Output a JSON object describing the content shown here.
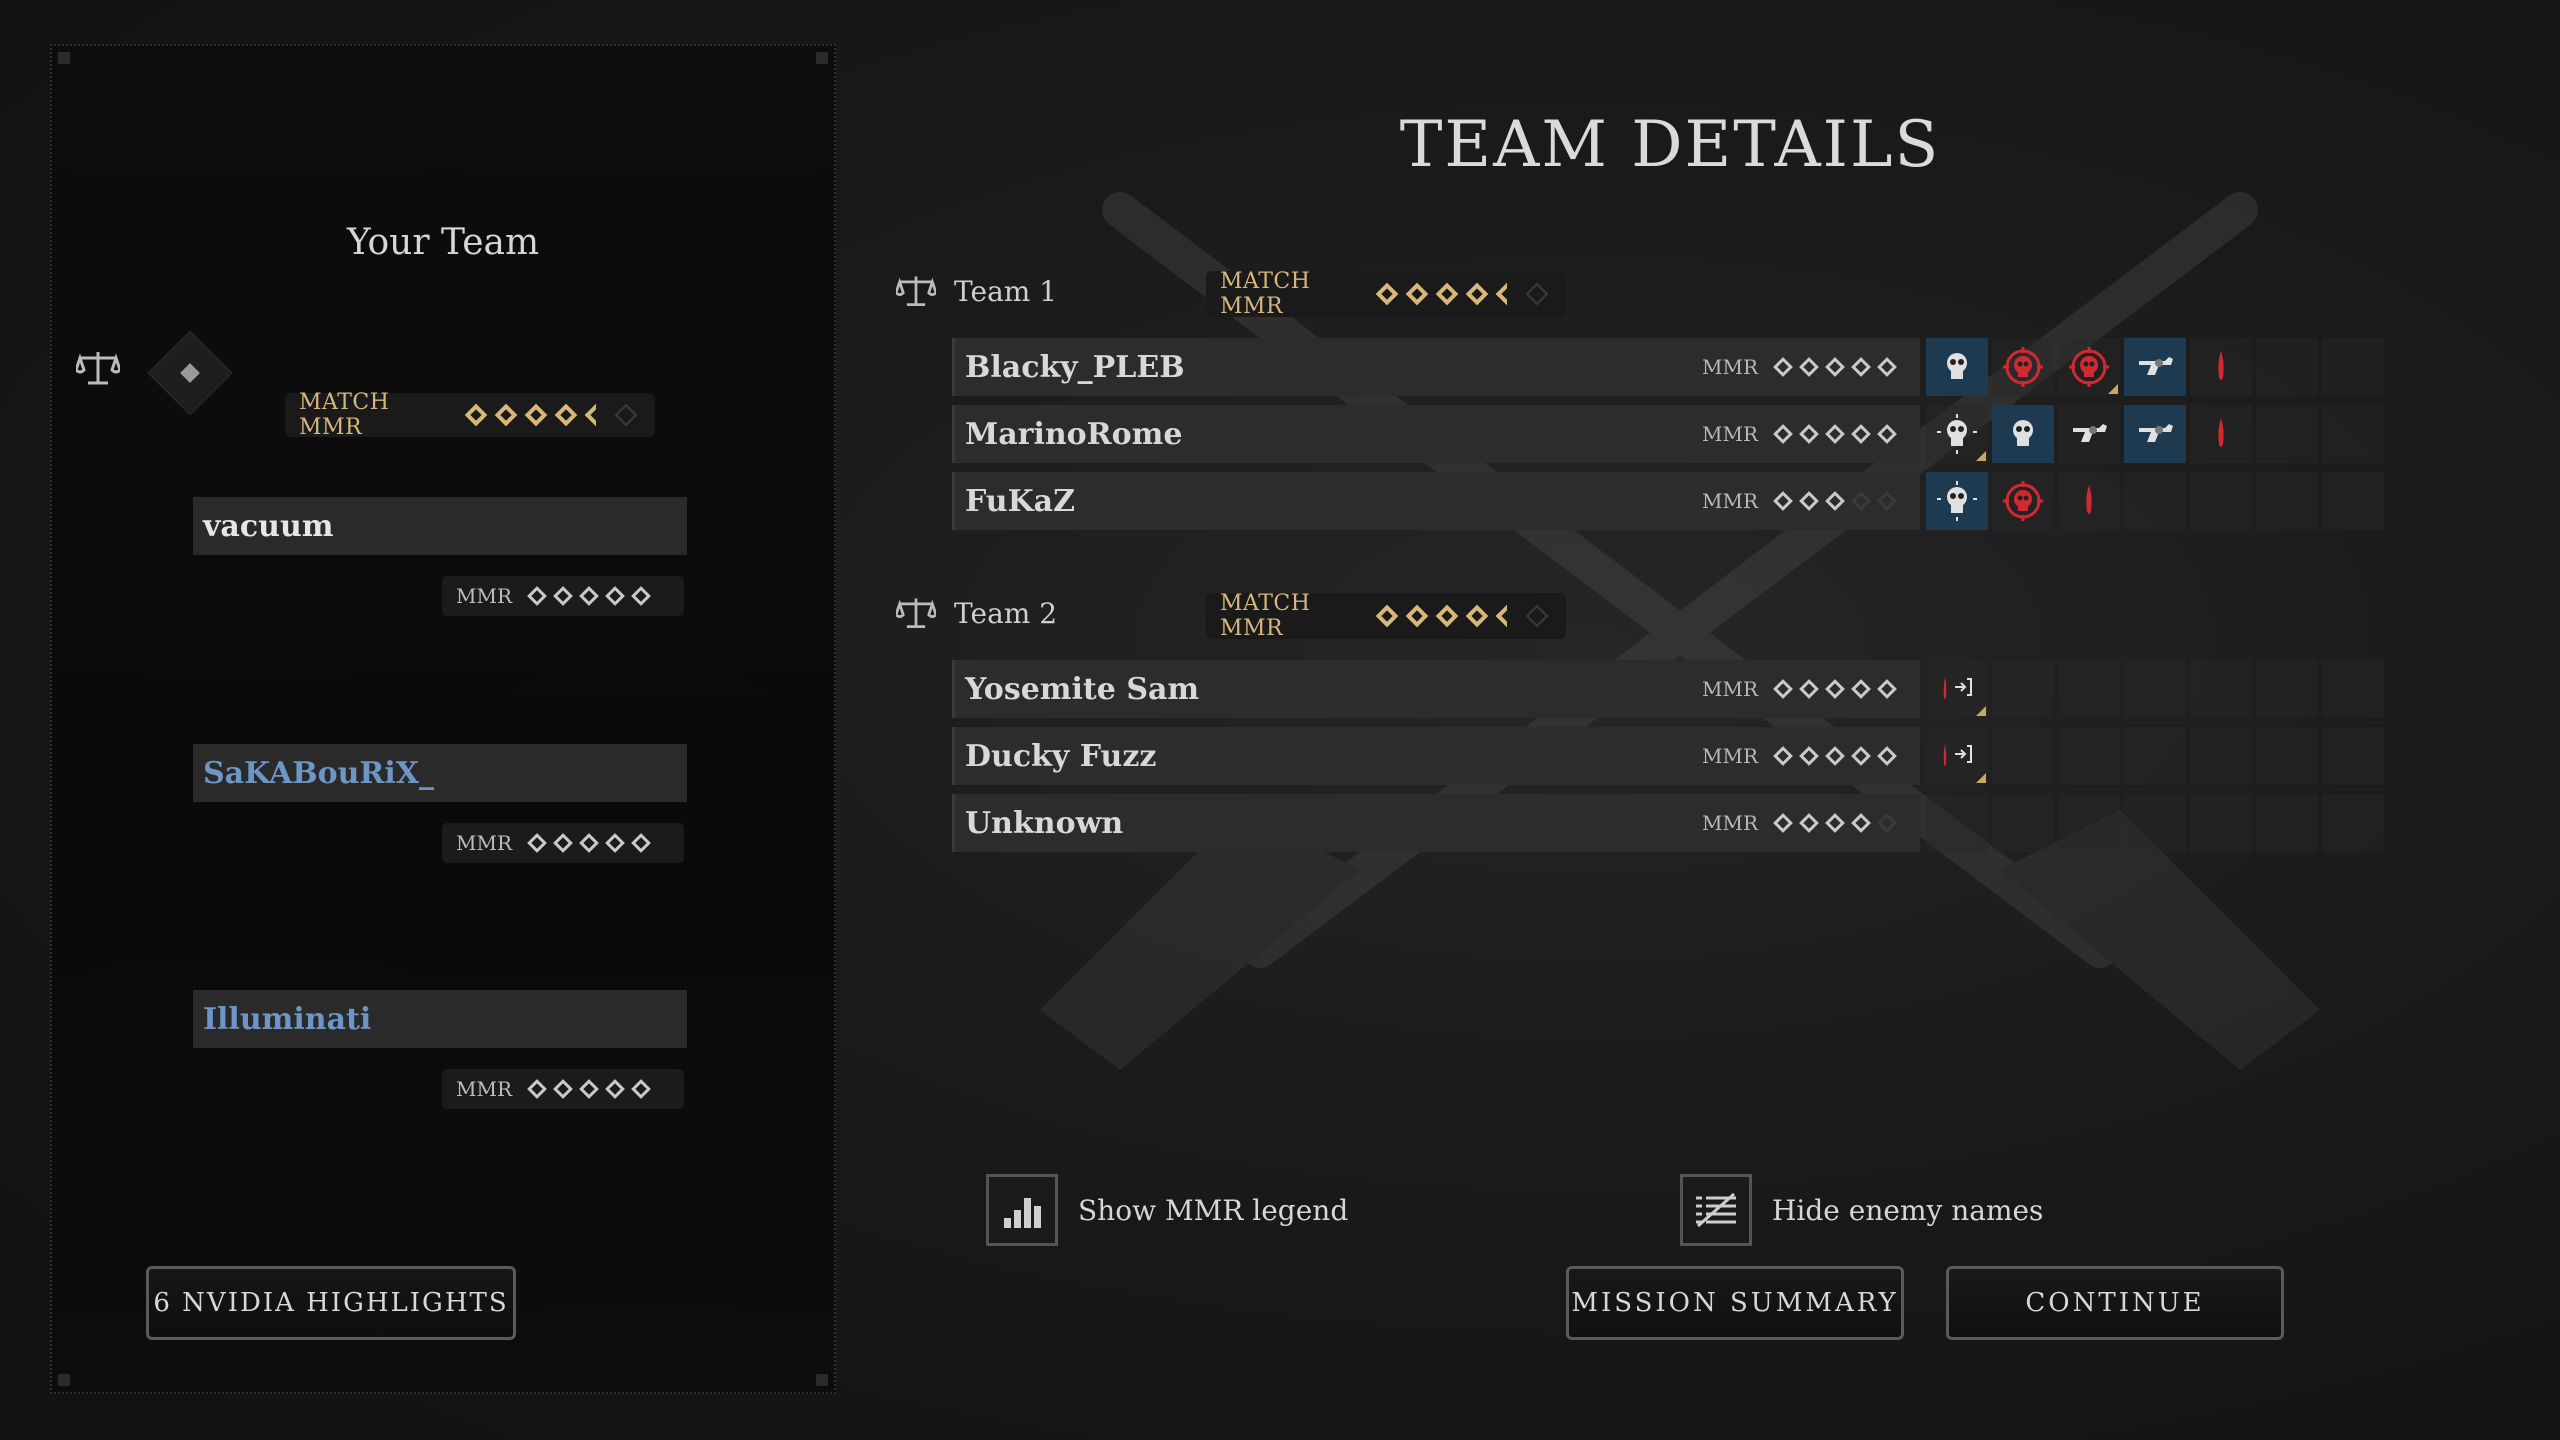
{
  "page": {
    "title": "TEAM DETAILS"
  },
  "left": {
    "title": "Your Team",
    "match_mmr_label": "MATCH MMR",
    "match_mmr_stars": 4.5,
    "players": [
      {
        "name": "vacuum",
        "mmr_label": "MMR",
        "stars": 5,
        "name_color": "#e6e6e6"
      },
      {
        "name": "SaKABouRiX_",
        "mmr_label": "MMR",
        "stars": 5,
        "name_color": "#6c95c8"
      },
      {
        "name": "Illuminati",
        "mmr_label": "MMR",
        "stars": 5,
        "name_color": "#6c95c8"
      }
    ],
    "highlights_button": "6 NVIDIA HIGHLIGHTS"
  },
  "teams": [
    {
      "name": "Team 1",
      "match_mmr_label": "MATCH MMR",
      "match_mmr_stars": 4.5,
      "players": [
        {
          "name": "Blacky_PLEB",
          "mmr_label": "MMR",
          "stars": 5,
          "events": [
            "skull-white-blue",
            "target-skull-red",
            "target-skull-red-marked",
            "revolver-blue",
            "blood-drop-red"
          ]
        },
        {
          "name": "MarinoRome",
          "mmr_label": "MMR",
          "stars": 5,
          "events": [
            "skull-crosshair-marked",
            "skull-white-blue",
            "revolver",
            "revolver-blue",
            "blood-drop-red"
          ]
        },
        {
          "name": "FuKaZ",
          "mmr_label": "MMR",
          "stars": 3,
          "events": [
            "skull-crosshair-blue",
            "target-skull-red",
            "blood-drop-red"
          ]
        }
      ]
    },
    {
      "name": "Team 2",
      "match_mmr_label": "MATCH MMR",
      "match_mmr_stars": 4.5,
      "players": [
        {
          "name": "Yosemite Sam",
          "mmr_label": "MMR",
          "stars": 5,
          "events": [
            "blood-exit-marked"
          ]
        },
        {
          "name": "Ducky Fuzz",
          "mmr_label": "MMR",
          "stars": 5,
          "events": [
            "blood-exit-marked"
          ]
        },
        {
          "name": "Unknown",
          "mmr_label": "MMR",
          "stars": 4,
          "events": []
        }
      ]
    }
  ],
  "options": {
    "show_mmr_legend": "Show MMR legend",
    "hide_enemy_names": "Hide enemy names"
  },
  "buttons": {
    "mission_summary": "MISSION SUMMARY",
    "continue": "CONTINUE"
  },
  "colors": {
    "gold": "#d8b878",
    "blue_name": "#6c95c8",
    "event_blue": "#1d3a50",
    "event_red": "#c0242a"
  }
}
